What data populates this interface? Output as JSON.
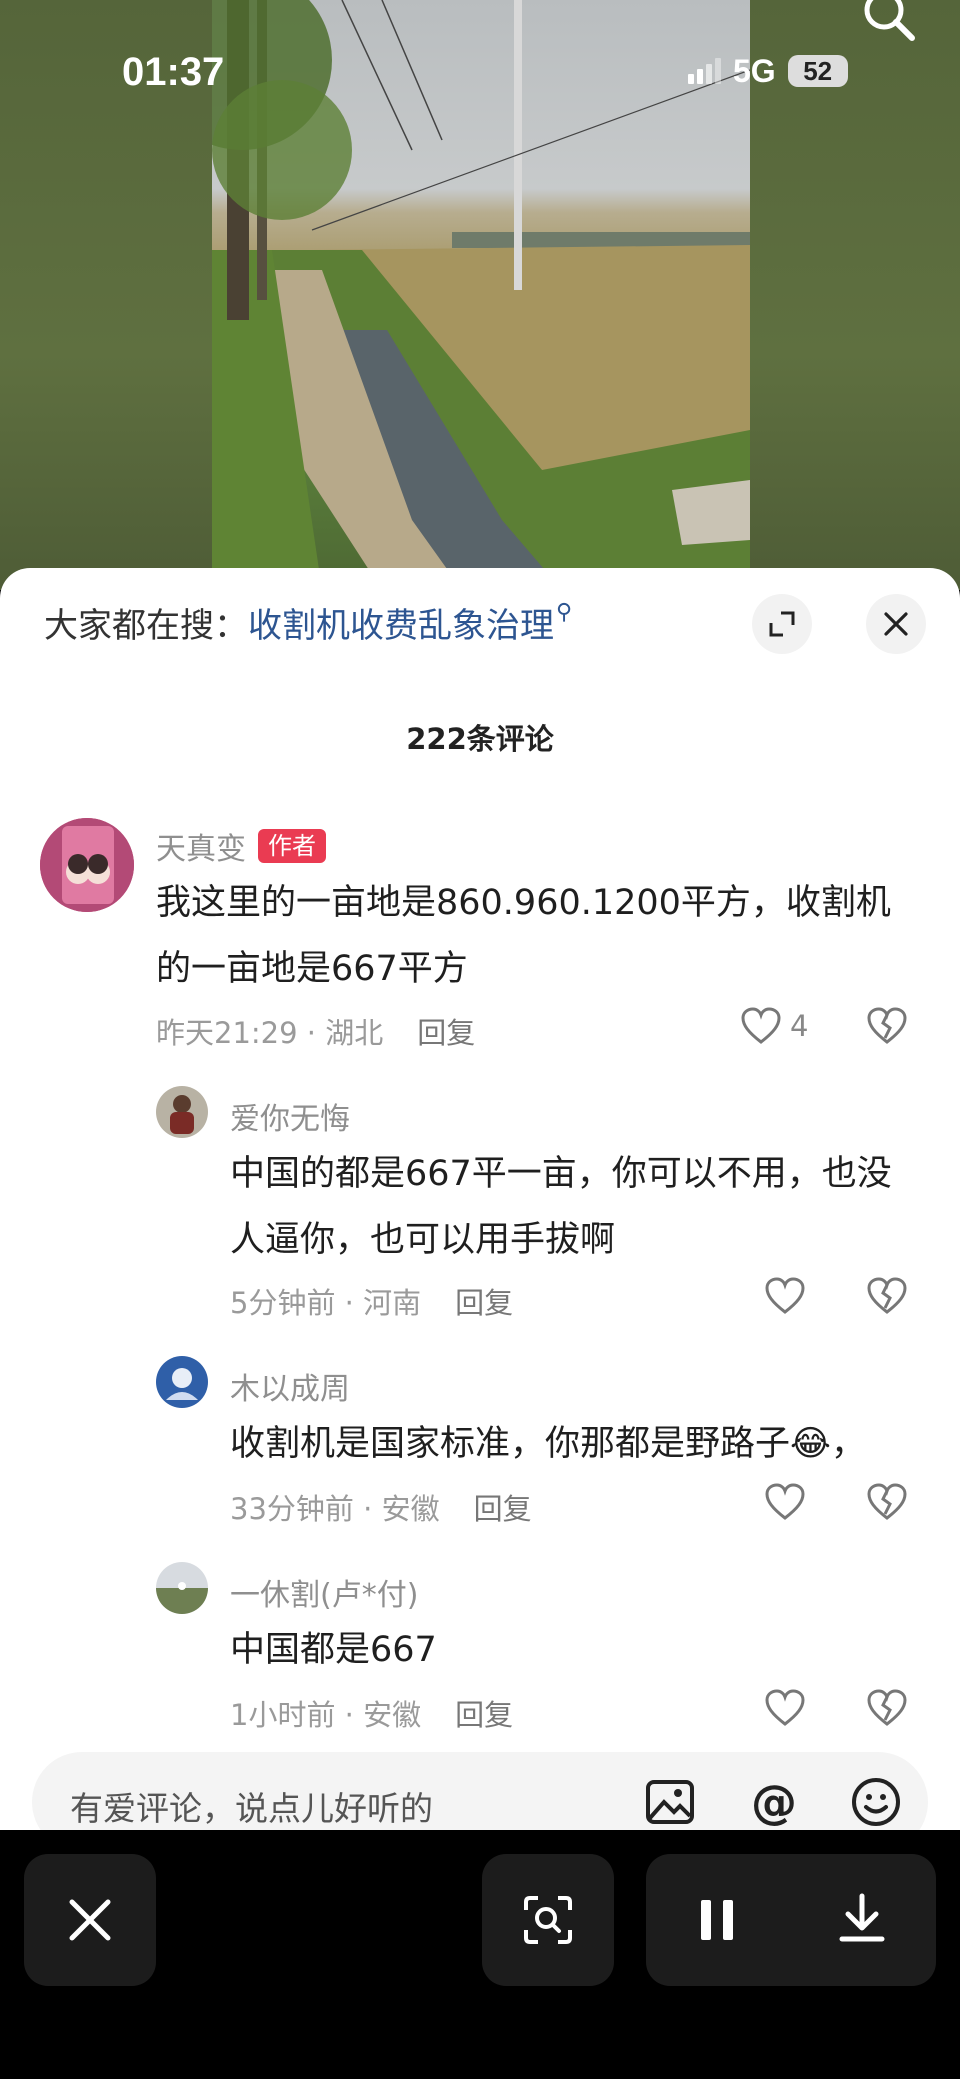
{
  "status_bar": {
    "time": "01:37",
    "network": "5G",
    "battery": "52"
  },
  "hot_search": {
    "prefix": "大家都在搜：",
    "term": "收割机收费乱象治理"
  },
  "comments_header": {
    "count_label": "222条评论"
  },
  "comments": [
    {
      "username": "天真变",
      "badge": "作者",
      "text": "我这里的一亩地是860.960.1200平方，收割机的一亩地是667平方",
      "time": "昨天21:29",
      "location": "湖北",
      "reply_label": "回复",
      "likes": "4"
    },
    {
      "username": "爱你无悔",
      "text": "中国的都是667平一亩，你可以不用，也没人逼你，也可以用手拔啊",
      "time": "5分钟前",
      "location": "河南",
      "reply_label": "回复"
    },
    {
      "username": "木以成周",
      "text": "收割机是国家标准，你那都是野路子😂，",
      "time": "33分钟前",
      "location": "安徽",
      "reply_label": "回复"
    },
    {
      "username": "一休割(卢*付)",
      "text": "中国都是667",
      "time": "1小时前",
      "location": "安徽",
      "reply_label": "回复"
    }
  ],
  "input_bar": {
    "placeholder": "有爱评论，说点儿好听的"
  },
  "icons": {
    "top_right": "search-icon",
    "expand": "expand-icon",
    "close": "close-icon",
    "like": "heart-icon",
    "dislike": "broken-heart-icon",
    "image": "image-icon",
    "mention": "at-icon",
    "emoji": "emoji-icon",
    "toolbar_close": "close-icon",
    "toolbar_lens": "lens-scan-icon",
    "toolbar_pause": "pause-icon",
    "toolbar_download": "download-icon"
  },
  "colors": {
    "author_badge": "#ea3b52",
    "hot_search_link": "#2d5591",
    "panel_bg": "#ffffff",
    "toolbar_bg": "#000000"
  }
}
